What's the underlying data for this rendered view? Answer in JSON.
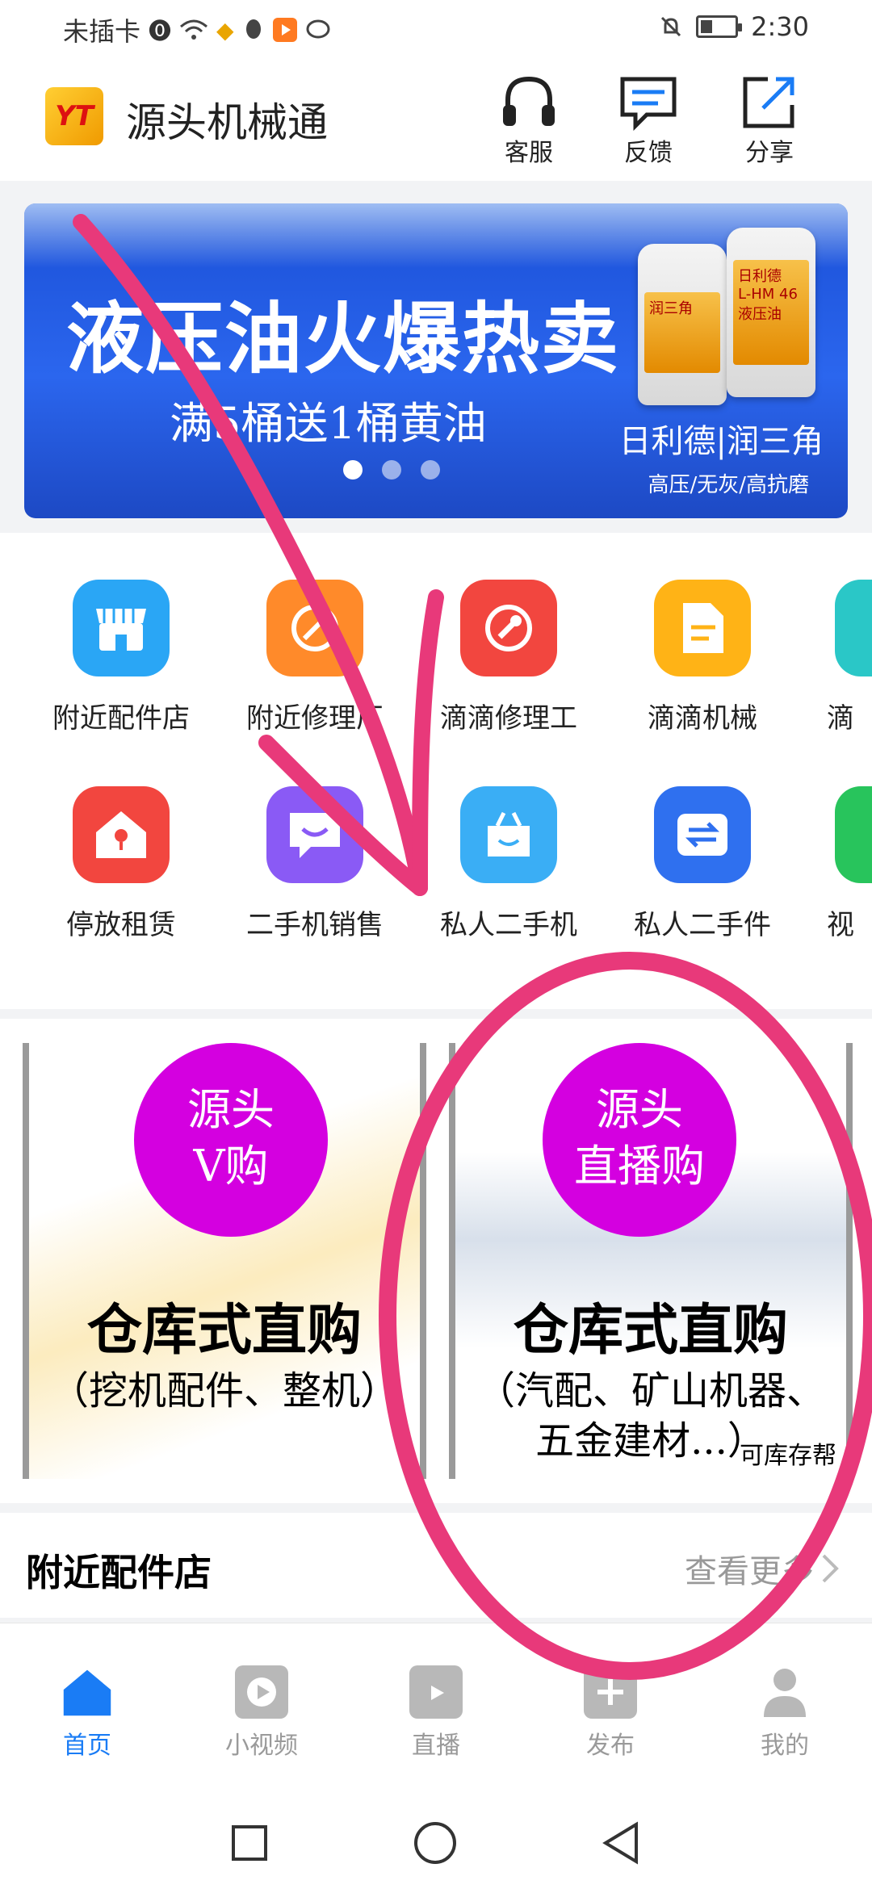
{
  "status_bar": {
    "carrier": "未插卡",
    "time": "2:30"
  },
  "header": {
    "title": "源头机械通",
    "logo_text": "YT",
    "buttons": [
      {
        "label": "客服",
        "icon": "headset-icon"
      },
      {
        "label": "反馈",
        "icon": "feedback-icon"
      },
      {
        "label": "分享",
        "icon": "share-icon"
      }
    ]
  },
  "banner": {
    "headline": "液压油火爆热卖",
    "subline": "满5桶送1桶黄油",
    "brands": "日利德|润三角",
    "tagline": "高压/无灰/高抗磨",
    "product_labels": [
      "润三角",
      "日利德",
      "L-HM 46",
      "液压油"
    ],
    "dots": 3,
    "active_dot": 0
  },
  "grid": {
    "row1": [
      {
        "label": "附近配件店",
        "color": "#2aa6f5",
        "icon": "store-icon"
      },
      {
        "label": "附近修理厂",
        "color": "#ff8a2a",
        "icon": "repair-shop-icon"
      },
      {
        "label": "滴滴修理工",
        "color": "#f2463f",
        "icon": "wrench-icon"
      },
      {
        "label": "滴滴机械",
        "color": "#ffb316",
        "icon": "machine-icon"
      },
      {
        "label": "滴",
        "color": "#2ac7c7",
        "icon": "partial-icon"
      }
    ],
    "row2": [
      {
        "label": "停放租赁",
        "color": "#f2463f",
        "icon": "house-icon"
      },
      {
        "label": "二手机销售",
        "color": "#8a5af5",
        "icon": "chat-icon"
      },
      {
        "label": "私人二手机",
        "color": "#3aaef5",
        "icon": "bag-icon"
      },
      {
        "label": "私人二手件",
        "color": "#2f70ef",
        "icon": "exchange-icon"
      },
      {
        "label": "视",
        "color": "#28c45c",
        "icon": "partial-icon"
      }
    ]
  },
  "promo_cards": [
    {
      "badge_line1": "源头",
      "badge_line2": "V购",
      "title": "仓库式直购",
      "subtitle": "（挖机配件、整机）",
      "footer": ""
    },
    {
      "badge_line1": "源头",
      "badge_line2": "直播购",
      "title": "仓库式直购",
      "subtitle": "（汽配、矿山机器、五金建材...）",
      "footer": "可库存帮"
    }
  ],
  "nearby": {
    "title": "附近配件店",
    "more": "查看更多"
  },
  "tabbar": {
    "tabs": [
      {
        "label": "首页",
        "icon": "home-icon",
        "active": true
      },
      {
        "label": "小视频",
        "icon": "video-icon",
        "active": false
      },
      {
        "label": "直播",
        "icon": "tv-icon",
        "active": false
      },
      {
        "label": "发布",
        "icon": "plus-icon",
        "active": false
      },
      {
        "label": "我的",
        "icon": "user-icon",
        "active": false
      }
    ]
  },
  "colors": {
    "accent": "#1a7cf5",
    "annotation": "#e8397a",
    "badge": "#d400e0"
  }
}
